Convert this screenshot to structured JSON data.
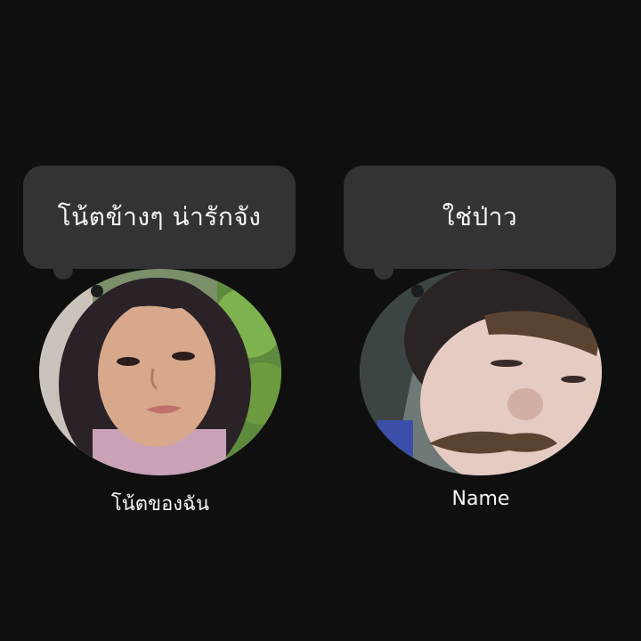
{
  "notes": [
    {
      "bubble_text": "โน้ตข้างๆ น่ารักจัง",
      "name": "โน้ตของฉัน",
      "avatar_icon": "profile-photo-girl-bangs"
    },
    {
      "bubble_text": "ใช่ป่าว",
      "name": "Name",
      "avatar_icon": "profile-photo-mustache-filter"
    }
  ],
  "colors": {
    "background": "#0f0f0f",
    "bubble": "#333335",
    "text": "#f5f5f5"
  }
}
